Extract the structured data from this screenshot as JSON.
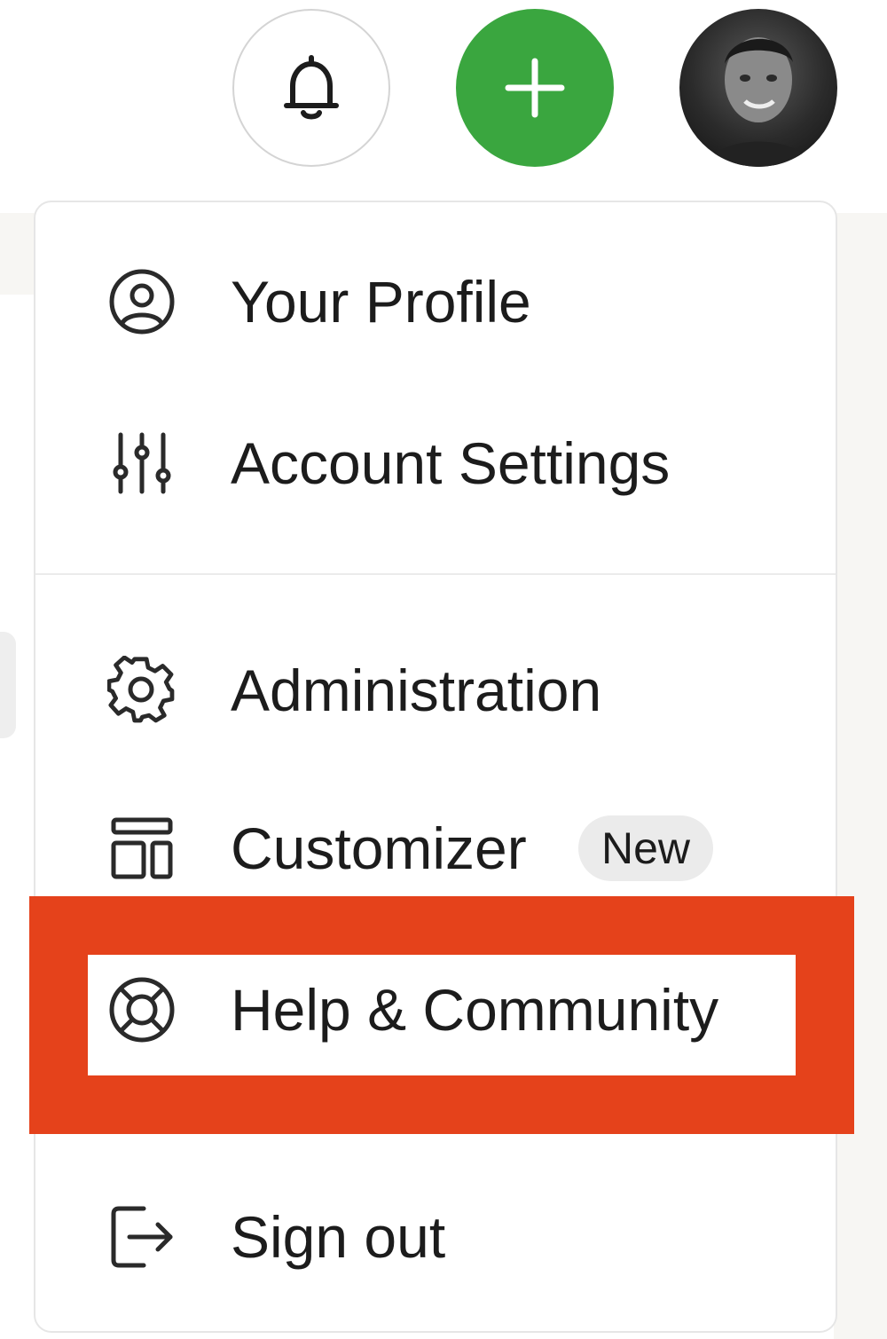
{
  "topbar": {
    "notifications_icon": "bell-icon",
    "create_icon": "plus-icon",
    "avatar_icon": "user-avatar",
    "create_color": "#3aa63f"
  },
  "menu": {
    "items": [
      {
        "label": "Your Profile",
        "icon": "user-circle-icon"
      },
      {
        "label": "Account Settings",
        "icon": "sliders-icon"
      },
      {
        "label": "Administration",
        "icon": "gear-icon"
      },
      {
        "label": "Customizer",
        "icon": "layout-icon",
        "badge": "New"
      },
      {
        "label": "Help & Community",
        "icon": "lifebuoy-icon"
      },
      {
        "label": "Sign out",
        "icon": "sign-out-icon"
      }
    ]
  },
  "highlight_color": "#e5421b"
}
